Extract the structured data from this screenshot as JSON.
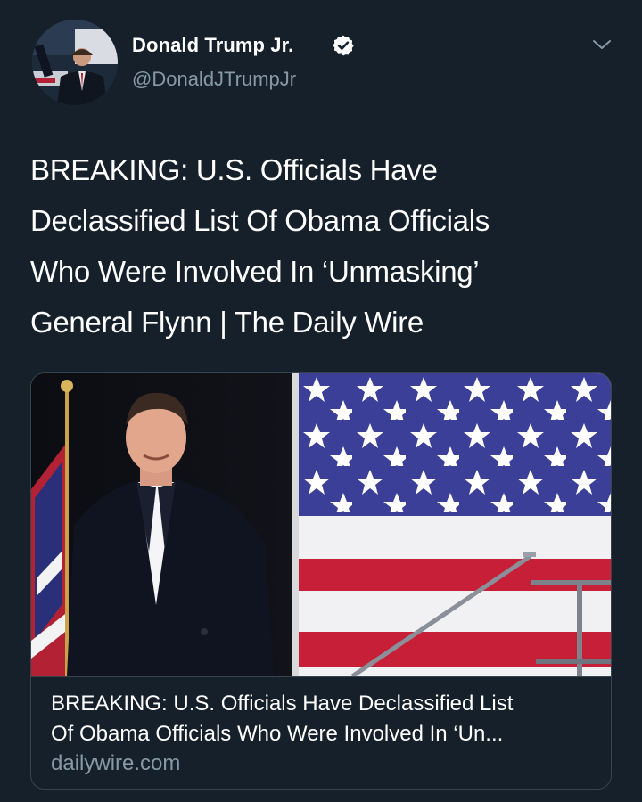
{
  "author": {
    "name": "Donald Trump Jr.",
    "handle": "@DonaldJTrumpJr",
    "verified": true
  },
  "tweet": {
    "text_lines": [
      "BREAKING: U.S. Officials Have",
      "Declassified List Of Obama Officials",
      "Who Were Involved In ‘Unmasking’",
      "General Flynn | The Daily Wire"
    ]
  },
  "card": {
    "title_lines": [
      "BREAKING: U.S. Officials Have Declassified List",
      "Of Obama Officials Who Were Involved In ‘Un..."
    ],
    "domain": "dailywire.com"
  },
  "icons": {
    "verified": "verified-badge-icon",
    "menu": "chevron-down-icon"
  },
  "colors": {
    "background": "#15202b",
    "text": "#ffffff",
    "secondary_text": "#8899a6",
    "border": "#38444d",
    "accent": "#1da1f2"
  }
}
